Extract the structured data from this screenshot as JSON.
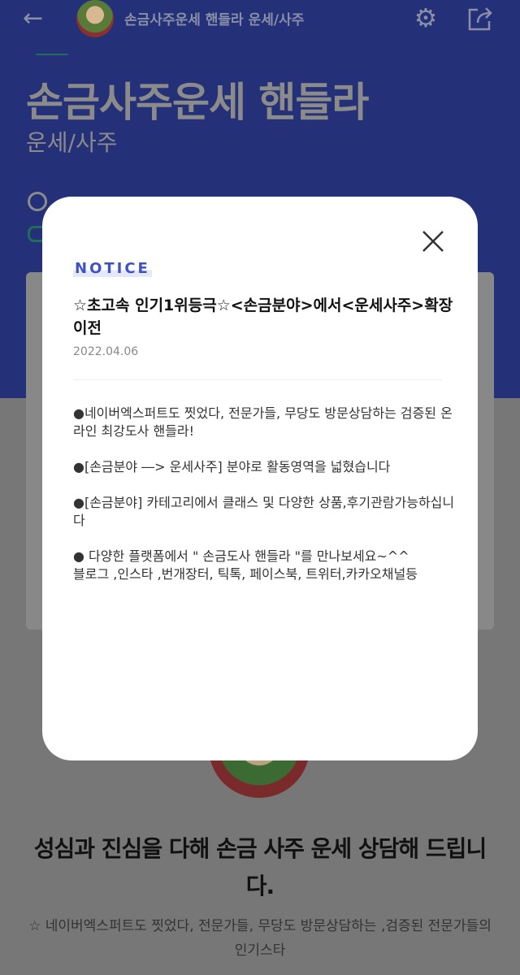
{
  "topbar": {
    "title": "손금사주운세 핸들라 운세/사주",
    "back_icon": "arrow-left-icon",
    "settings_icon": "gear-icon",
    "share_icon": "share-icon"
  },
  "header": {
    "title": "손금사주운세 핸들라",
    "category": "운세/사주"
  },
  "colors": {
    "hero": "#243078",
    "notice_accent": "#3f51c6",
    "overlay": "#777777"
  },
  "modal": {
    "label": "NOTICE",
    "title": "☆초고속 인기1위등극☆<손금분야>에서<운세사주>확장이전",
    "date": "2022.04.06",
    "paragraphs": [
      "●네이버엑스퍼트도 찟었다, 전문가들, 무당도 방문상담하는 검증된 온라인 최강도사 핸들라!",
      "●[손금분야 ―> 운세사주] 분야로 활동영역을 넓혔습니다",
      "●[손금분야] 카테고리에서 클래스 및 다양한 상품,후기관람가능하십니다",
      "● 다양한 플랫폼에서 \" 손금도사 핸들라 \"를 만나보세요~^^\n블로그 ,인스타 ,번개장터, 틱톡, 페이스북, 트위터,카카오채널등"
    ]
  },
  "content": {
    "headline": "성심과 진심을 다해 손금 사주 운세 상담해 드립니다.",
    "description": "☆ 네이버엑스퍼트도 찟었다, 전문가들, 무당도 방문상담하는 ,검증된 전문가들의 인기스타"
  }
}
